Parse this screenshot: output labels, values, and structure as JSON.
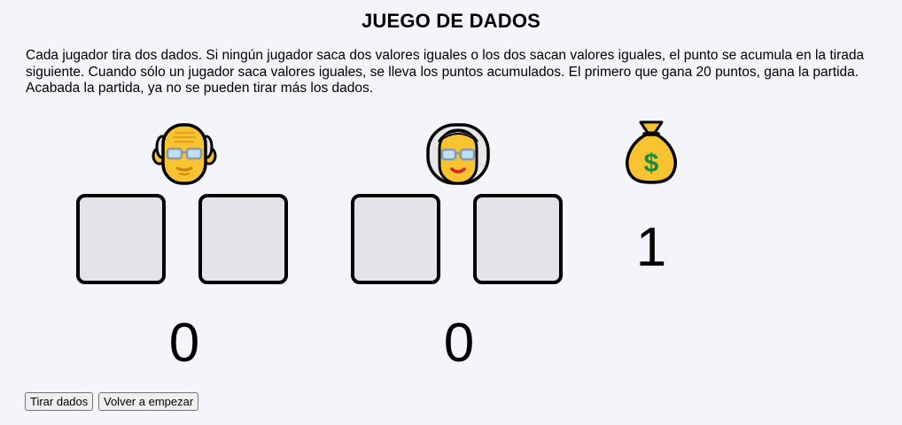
{
  "page": {
    "title": "JUEGO DE DADOS",
    "description": "Cada jugador tira dos dados. Si ningún jugador saca dos valores iguales o los dos sacan valores iguales, el punto se acumula en la tirada siguiente. Cuando sólo un jugador saca valores iguales, se lleva los puntos acumulados. El primero que gana 20 puntos, gana la partida. Acabada la partida, ya no se pueden tirar más los dados."
  },
  "players": [
    {
      "icon": "old-man-icon",
      "score": "0"
    },
    {
      "icon": "old-woman-icon",
      "score": "0"
    }
  ],
  "pot": {
    "icon": "money-bag-icon",
    "value": "1"
  },
  "buttons": {
    "roll": "Tirar dados",
    "restart": "Volver a empezar"
  }
}
